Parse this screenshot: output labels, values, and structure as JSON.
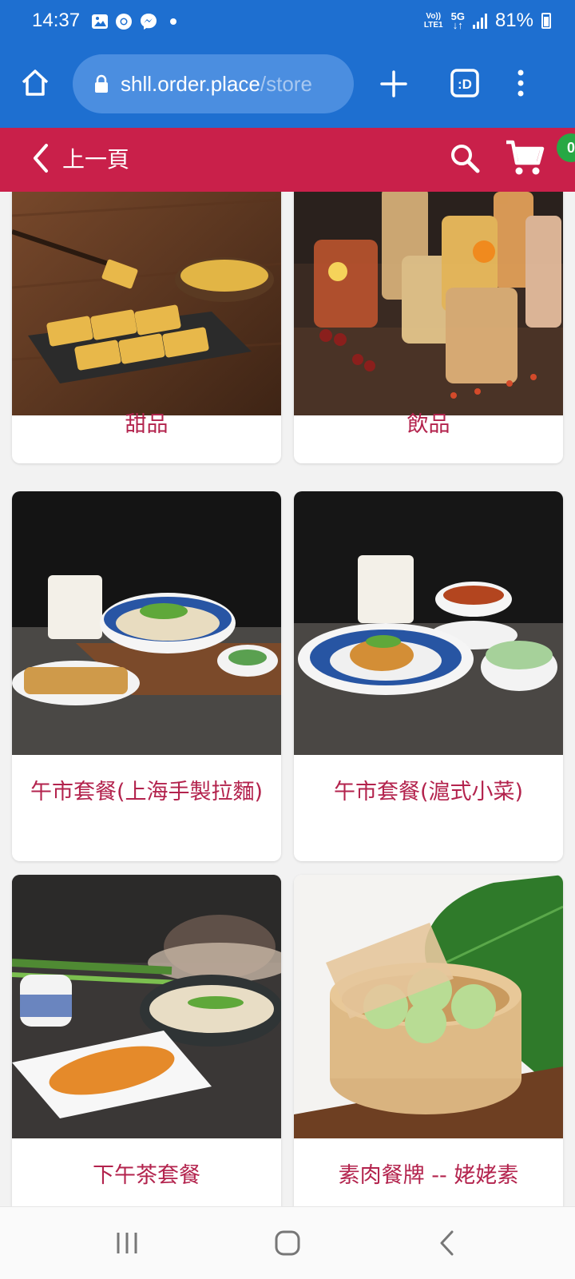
{
  "status_bar": {
    "time": "14:37",
    "network_top": "Vo))",
    "network_bottom": "LTE1",
    "network_type": "5G",
    "battery": "81%"
  },
  "browser": {
    "url_main": "shll.order.place",
    "url_dim": "/store"
  },
  "app_bar": {
    "back_label": "上一頁",
    "cart_count": "0",
    "accent_color": "#c9204a"
  },
  "categories": [
    {
      "label": "甜品",
      "image": "dessert-photo"
    },
    {
      "label": "飲品",
      "image": "drinks-photo"
    },
    {
      "label": "午市套餐(上海手製拉麵)",
      "image": "lunch-set-noodles-photo"
    },
    {
      "label": "午市套餐(滬式小菜)",
      "image": "lunch-set-shanghai-dishes-photo"
    },
    {
      "label": "下午茶套餐",
      "image": "afternoon-tea-set-photo"
    },
    {
      "label": "素肉餐牌 -- 姥姥素",
      "image": "vegetarian-menu-photo"
    }
  ]
}
